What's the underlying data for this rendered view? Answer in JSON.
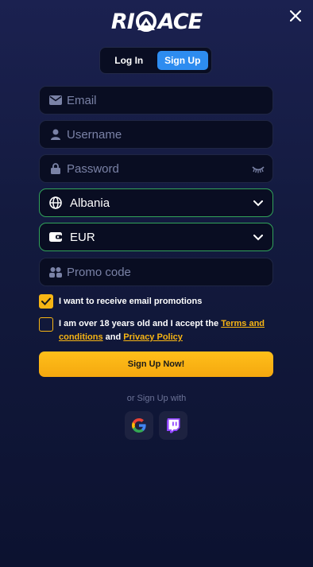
{
  "brand": {
    "logo_left": "RI",
    "logo_right": "ACE"
  },
  "tabs": [
    {
      "label": "Log In",
      "active": false
    },
    {
      "label": "Sign Up",
      "active": true
    }
  ],
  "fields": {
    "email": {
      "placeholder": "Email",
      "icon": "envelope-icon"
    },
    "username": {
      "placeholder": "Username",
      "icon": "user-icon"
    },
    "password": {
      "placeholder": "Password",
      "icon": "lock-icon",
      "right_icon": "eye-closed-icon"
    },
    "country": {
      "value": "Albania",
      "icon": "globe-icon"
    },
    "currency": {
      "value": "EUR",
      "icon": "wallet-icon"
    },
    "promo": {
      "placeholder": "Promo code",
      "icon": "users-icon"
    }
  },
  "checks": {
    "promotions": {
      "checked": true,
      "text": "I want to receive email promotions"
    },
    "terms": {
      "checked": false,
      "text_before": "I am over 18 years old and I accept the ",
      "terms_link": "Terms and conditions",
      "text_mid": " and ",
      "privacy_link": "Privacy Policy"
    }
  },
  "submit_label": "Sign Up Now!",
  "social": {
    "label": "or Sign Up with",
    "providers": [
      "Google",
      "Twitch"
    ]
  },
  "colors": {
    "accent": "#f7b514",
    "tab_active": "#2d8cf0",
    "select_border": "#32a35a",
    "background": "#131a3e"
  }
}
